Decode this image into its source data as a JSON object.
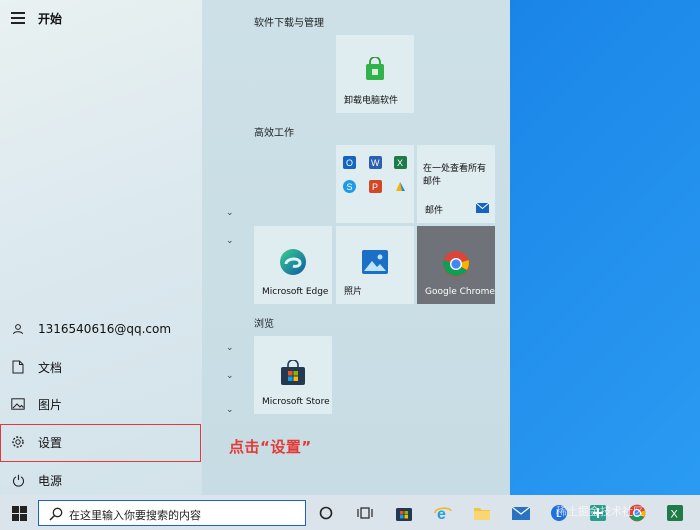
{
  "start_menu": {
    "title": "开始",
    "user": "1316540616@qq.com",
    "items": [
      "文档",
      "图片",
      "设置",
      "电源"
    ]
  },
  "groups": {
    "software": "软件下载与管理",
    "work": "高效工作",
    "browse": "浏览"
  },
  "tiles": {
    "uninstall": "卸载电脑软件",
    "mail_tile_text": "在一处查看所有邮件",
    "mail": "邮件",
    "edge": "Microsoft Edge",
    "photos": "照片",
    "chrome": "Google Chrome",
    "store": "Microsoft Store"
  },
  "annotation": "点击“设置”",
  "taskbar": {
    "search_placeholder": "在这里输入你要搜索的内容"
  },
  "watermark": "稀土掘金技术社区",
  "colors": {
    "highlight": "#e03a3a",
    "accent": "#1a63c8"
  }
}
